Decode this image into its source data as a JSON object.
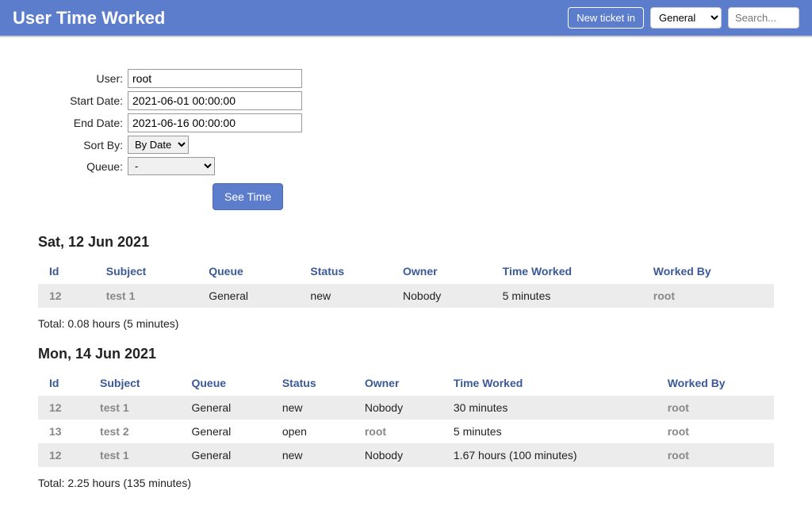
{
  "header": {
    "title": "User Time Worked",
    "new_ticket_label": "New ticket in",
    "queue_selected": "General",
    "search_placeholder": "Search..."
  },
  "form": {
    "user_label": "User:",
    "user_value": "root",
    "start_date_label": "Start Date:",
    "start_date_value": "2021-06-01 00:00:00",
    "end_date_label": "End Date:",
    "end_date_value": "2021-06-16 00:00:00",
    "sort_by_label": "Sort By:",
    "sort_by_value": "By Date",
    "queue_label": "Queue:",
    "queue_value": "-",
    "submit_label": "See Time"
  },
  "columns": {
    "id": "Id",
    "subject": "Subject",
    "queue": "Queue",
    "status": "Status",
    "owner": "Owner",
    "time_worked": "Time Worked",
    "worked_by": "Worked By"
  },
  "groups": [
    {
      "heading": "Sat, 12 Jun 2021",
      "rows": [
        {
          "id": "12",
          "subject": "test 1",
          "queue": "General",
          "status": "new",
          "owner": "Nobody",
          "owner_link": false,
          "time_worked": "5 minutes",
          "worked_by": "root"
        }
      ],
      "total": "Total: 0.08 hours (5 minutes)"
    },
    {
      "heading": "Mon, 14 Jun 2021",
      "rows": [
        {
          "id": "12",
          "subject": "test 1",
          "queue": "General",
          "status": "new",
          "owner": "Nobody",
          "owner_link": false,
          "time_worked": "30 minutes",
          "worked_by": "root"
        },
        {
          "id": "13",
          "subject": "test 2",
          "queue": "General",
          "status": "open",
          "owner": "root",
          "owner_link": true,
          "time_worked": "5 minutes",
          "worked_by": "root"
        },
        {
          "id": "12",
          "subject": "test 1",
          "queue": "General",
          "status": "new",
          "owner": "Nobody",
          "owner_link": false,
          "time_worked": "1.67 hours (100 minutes)",
          "worked_by": "root"
        }
      ],
      "total": "Total: 2.25 hours (135 minutes)"
    }
  ]
}
